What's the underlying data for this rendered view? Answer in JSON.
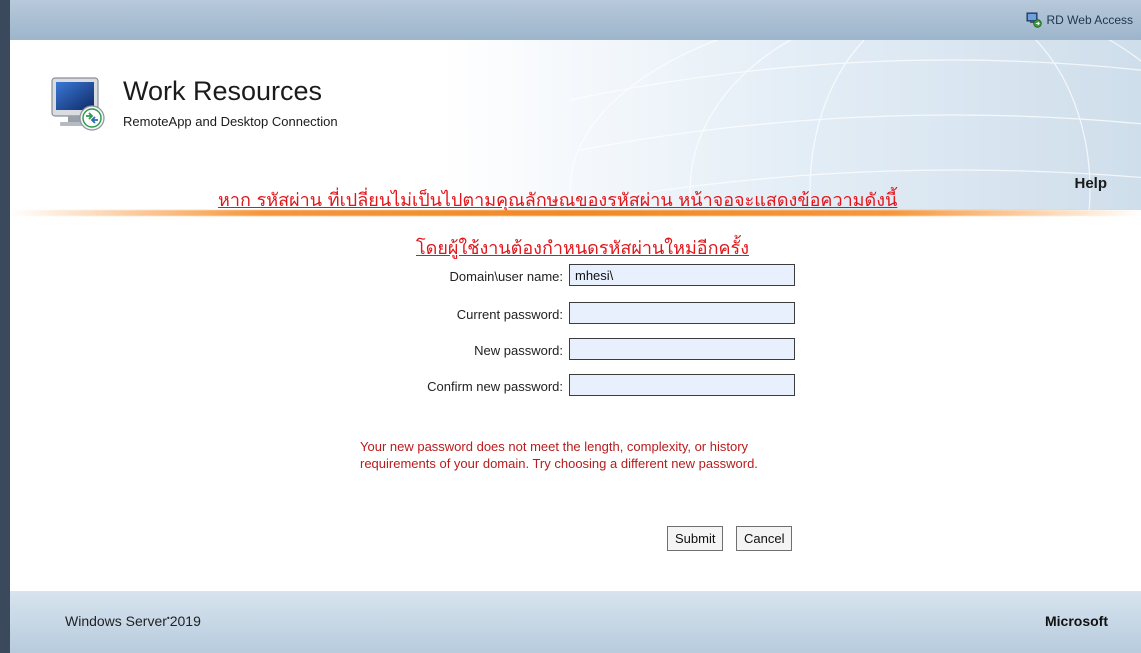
{
  "topbar": {
    "label": "RD Web Access",
    "icon": "rd-web-access-icon"
  },
  "header": {
    "title": "Work Resources",
    "subtitle": "RemoteApp and Desktop Connection",
    "help_label": "Help",
    "icon": "remoteapp-monitor-icon"
  },
  "annotations": {
    "line1": "หาก รหัสผ่าน ที่เปลี่ยนไม่เป็นไปตามคุณลักษณของรหัสผ่าน หน้าจอจะแสดงข้อความดังนี้",
    "line2": "โดยผู้ใช้งานต้องกำหนดรหัสผ่านใหม่อีกครั้ง"
  },
  "form": {
    "username_label": "Domain\\user name:",
    "username_value": "mhesi\\",
    "current_password_label": "Current password:",
    "current_password_value": "",
    "new_password_label": "New password:",
    "new_password_value": "",
    "confirm_password_label": "Confirm new password:",
    "confirm_password_value": "",
    "error_message": "Your new password does not meet the length, complexity, or history requirements of your domain. Try choosing a different new password.",
    "submit_label": "Submit",
    "cancel_label": "Cancel"
  },
  "footer": {
    "product": "Windows Server",
    "product_mark": "•",
    "product_version": "2019",
    "brand": "Microsoft"
  },
  "colors": {
    "annotation_red": "#e0161b",
    "error_red": "#b81c1c",
    "accent_orange": "#f08a24",
    "header_blue": "#9db5cc"
  }
}
